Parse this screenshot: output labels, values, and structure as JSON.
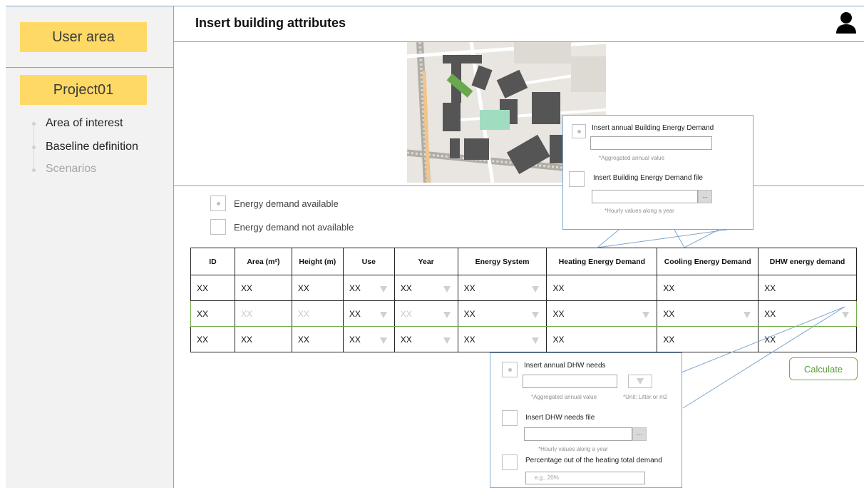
{
  "sidebar": {
    "user_area": "User area",
    "project": "Project01",
    "nav": [
      {
        "label": "Area of interest",
        "enabled": true
      },
      {
        "label": "Baseline definition",
        "enabled": true
      },
      {
        "label": "Scenarios",
        "enabled": false
      }
    ]
  },
  "header": {
    "title": "Insert building attributes"
  },
  "options": {
    "available": "Energy demand available",
    "not_available": "Energy demand not available"
  },
  "table": {
    "columns": [
      "ID",
      "Area (m²)",
      "Height (m)",
      "Use",
      "Year",
      "Energy System",
      "Heating Energy Demand",
      "Cooling Energy Demand",
      "DHW energy demand"
    ],
    "rows": [
      [
        "XX",
        "XX",
        "XX",
        "XX",
        "XX",
        "XX",
        "XX",
        "XX",
        "XX"
      ],
      [
        "XX",
        "XX",
        "XX",
        "XX",
        "XX",
        "XX",
        "XX",
        "XX",
        "XX"
      ],
      [
        "XX",
        "XX",
        "XX",
        "XX",
        "XX",
        "XX",
        "XX",
        "XX",
        "XX"
      ]
    ]
  },
  "energy_popup": {
    "annual_label": "Insert annual Building Energy Demand",
    "annual_note": "*Aggregated annual value",
    "file_label": "Insert Building Energy Demand file",
    "file_note": "*Hourly values along a year",
    "browse": "..."
  },
  "dhw_popup": {
    "annual_label": "Insert annual DHW needs",
    "annual_note": "*Aggregated annual value",
    "unit_note": "*Unit: Litter or m2",
    "file_label": "Insert DHW needs file",
    "file_note": "*Hourly values along a year",
    "percentage_label": "Percentage out of the heating total demand",
    "percentage_placeholder": "e.g., 20%",
    "browse": "..."
  },
  "calculate": "Calculate",
  "colors": {
    "accent_yellow": "#ffd966",
    "line_blue": "#7fa6cf",
    "green": "#70ad47"
  }
}
